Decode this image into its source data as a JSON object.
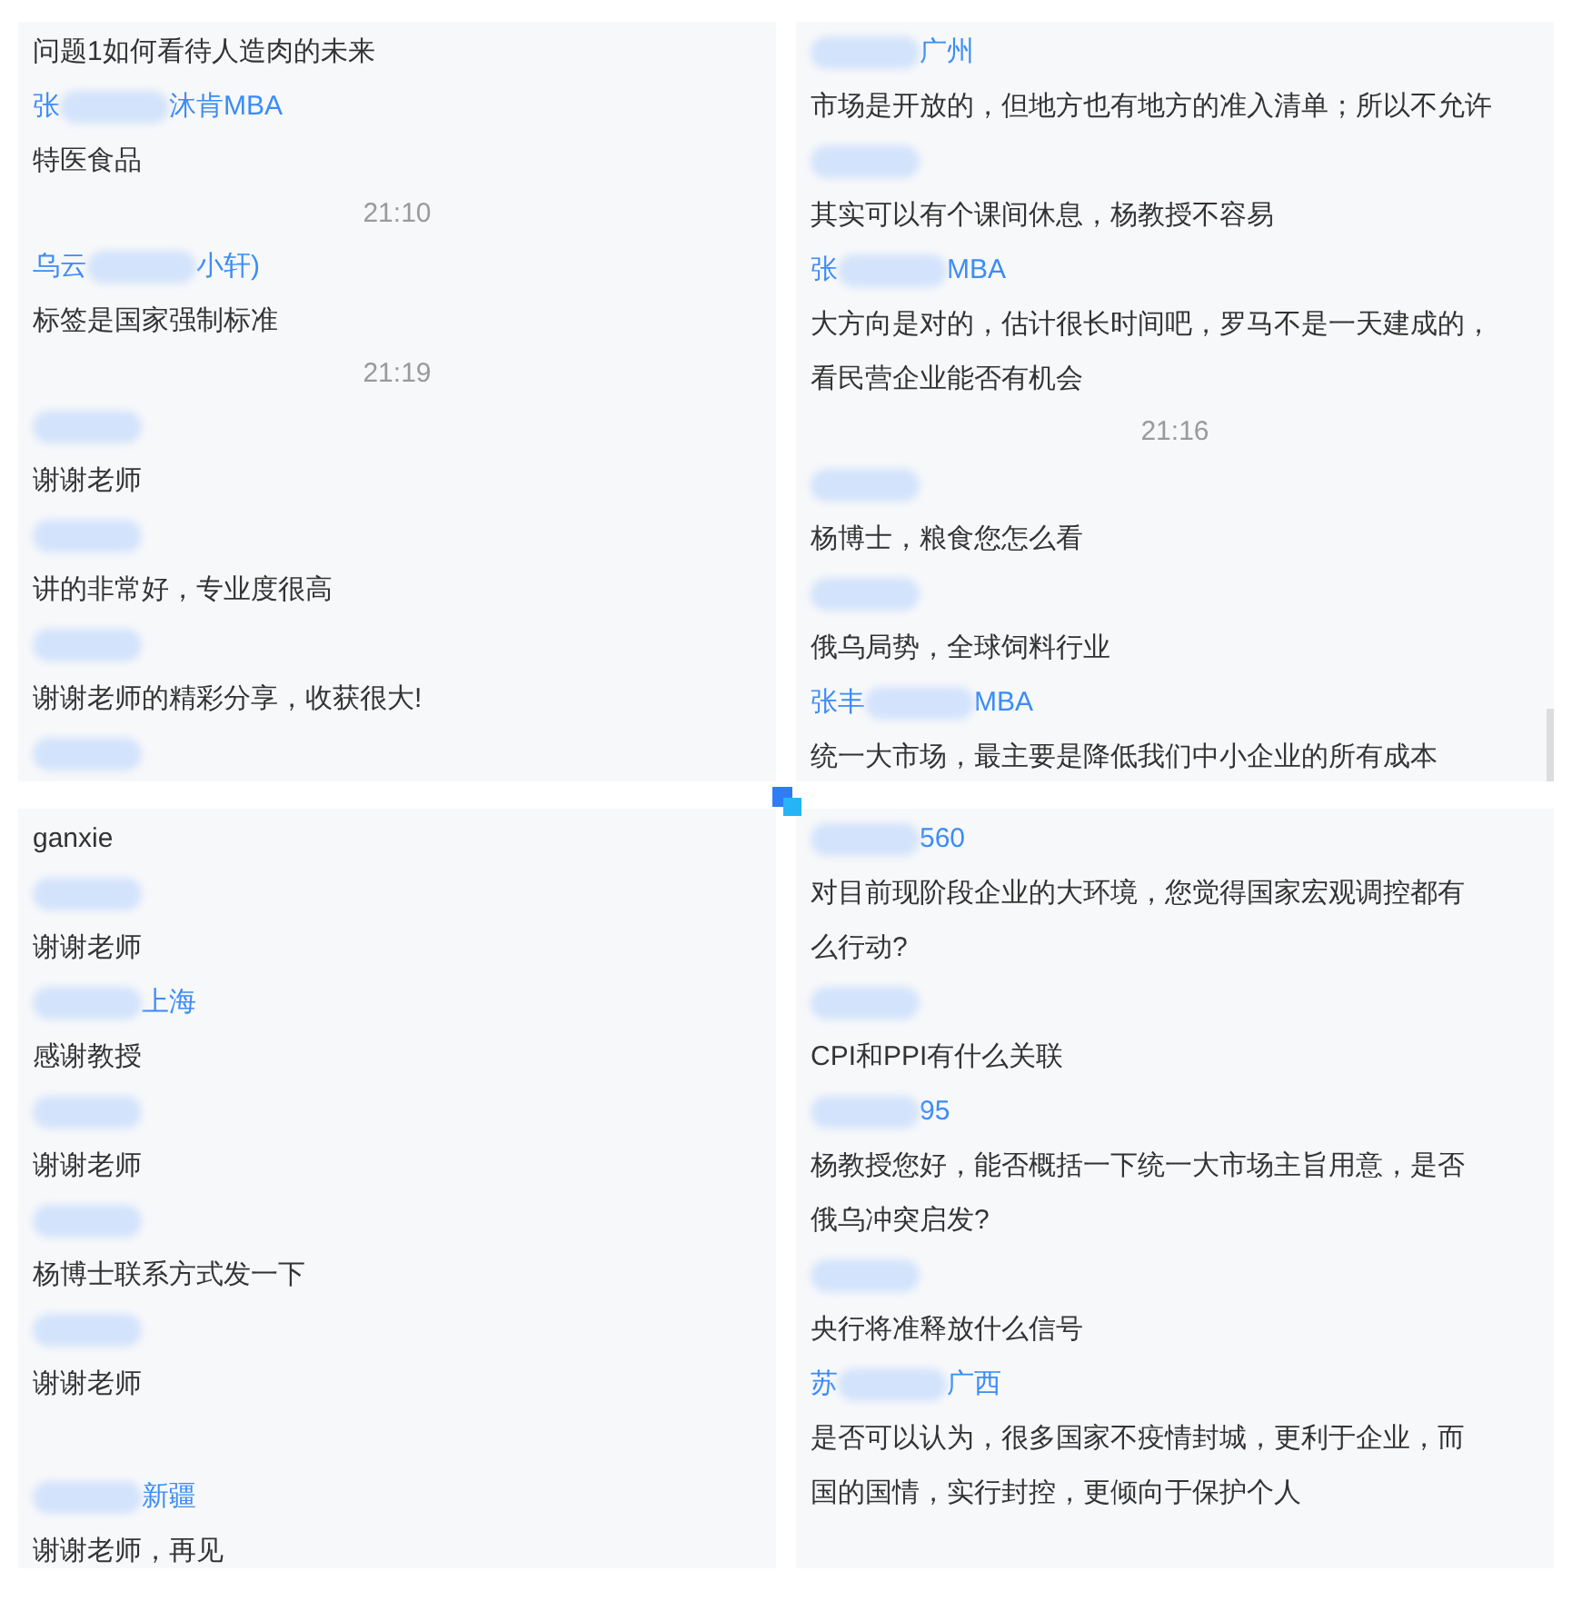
{
  "panels": [
    {
      "items": [
        {
          "kind": "text",
          "lines": [
            "问题1如何看待人造肉的未来"
          ]
        },
        {
          "kind": "name",
          "before": "张",
          "after": "沐肯MBA"
        },
        {
          "kind": "text",
          "lines": [
            "特医食品"
          ]
        },
        {
          "kind": "time",
          "text": "21:10"
        },
        {
          "kind": "name",
          "before": "乌云",
          "after": "小轩)"
        },
        {
          "kind": "text",
          "lines": [
            "标签是国家强制标准"
          ]
        },
        {
          "kind": "time",
          "text": "21:19"
        },
        {
          "kind": "name"
        },
        {
          "kind": "text",
          "lines": [
            "谢谢老师"
          ]
        },
        {
          "kind": "name"
        },
        {
          "kind": "text",
          "lines": [
            "讲的非常好，专业度很高"
          ]
        },
        {
          "kind": "name"
        },
        {
          "kind": "text",
          "lines": [
            "谢谢老师的精彩分享，收获很大!"
          ]
        },
        {
          "kind": "name"
        }
      ],
      "scrollbar": false
    },
    {
      "items": [
        {
          "kind": "name",
          "after": "广州"
        },
        {
          "kind": "text",
          "lines": [
            "市场是开放的，但地方也有地方的准入清单；所以不允许"
          ]
        },
        {
          "kind": "name"
        },
        {
          "kind": "text",
          "lines": [
            "其实可以有个课间休息，杨教授不容易"
          ]
        },
        {
          "kind": "name",
          "before": "张",
          "after": "MBA"
        },
        {
          "kind": "text",
          "lines": [
            "大方向是对的，估计很长时间吧，罗马不是一天建成的，",
            "看民营企业能否有机会"
          ]
        },
        {
          "kind": "time",
          "text": "21:16"
        },
        {
          "kind": "name"
        },
        {
          "kind": "text",
          "lines": [
            "杨博士，粮食您怎么看"
          ]
        },
        {
          "kind": "name"
        },
        {
          "kind": "text",
          "lines": [
            "俄乌局势，全球饲料行业"
          ]
        },
        {
          "kind": "name",
          "before": "张丰",
          "after": "MBA"
        },
        {
          "kind": "text",
          "lines": [
            "统一大市场，最主要是降低我们中小企业的所有成本"
          ]
        }
      ],
      "scrollbar": true
    },
    {
      "items": [
        {
          "kind": "text",
          "lines": [
            "ganxie"
          ]
        },
        {
          "kind": "name"
        },
        {
          "kind": "text",
          "lines": [
            "谢谢老师"
          ]
        },
        {
          "kind": "name",
          "after": "上海"
        },
        {
          "kind": "text",
          "lines": [
            "感谢教授"
          ]
        },
        {
          "kind": "name"
        },
        {
          "kind": "text",
          "lines": [
            "谢谢老师"
          ]
        },
        {
          "kind": "name"
        },
        {
          "kind": "text",
          "lines": [
            "杨博士联系方式发一下"
          ]
        },
        {
          "kind": "name"
        },
        {
          "kind": "text",
          "lines": [
            "谢谢老师"
          ]
        },
        {
          "kind": "gap"
        },
        {
          "kind": "name",
          "after": "新疆"
        },
        {
          "kind": "text",
          "lines": [
            "谢谢老师，再见"
          ]
        }
      ],
      "scrollbar": false
    },
    {
      "items": [
        {
          "kind": "name",
          "after": "560"
        },
        {
          "kind": "text",
          "lines": [
            "对目前现阶段企业的大环境，您觉得国家宏观调控都有",
            "么行动?"
          ]
        },
        {
          "kind": "name"
        },
        {
          "kind": "text",
          "lines": [
            "CPI和PPI有什么关联"
          ]
        },
        {
          "kind": "name",
          "after": "95"
        },
        {
          "kind": "text",
          "lines": [
            "杨教授您好，能否概括一下统一大市场主旨用意，是否",
            "俄乌冲突启发?"
          ]
        },
        {
          "kind": "name"
        },
        {
          "kind": "text",
          "lines": [
            "央行将准释放什么信号"
          ]
        },
        {
          "kind": "name",
          "before": "苏",
          "after": "广西"
        },
        {
          "kind": "text",
          "lines": [
            "是否可以认为，很多国家不疫情封城，更利于企业，而",
            "国的国情，实行封控，更倾向于保护个人"
          ]
        }
      ],
      "scrollbar": false
    }
  ]
}
